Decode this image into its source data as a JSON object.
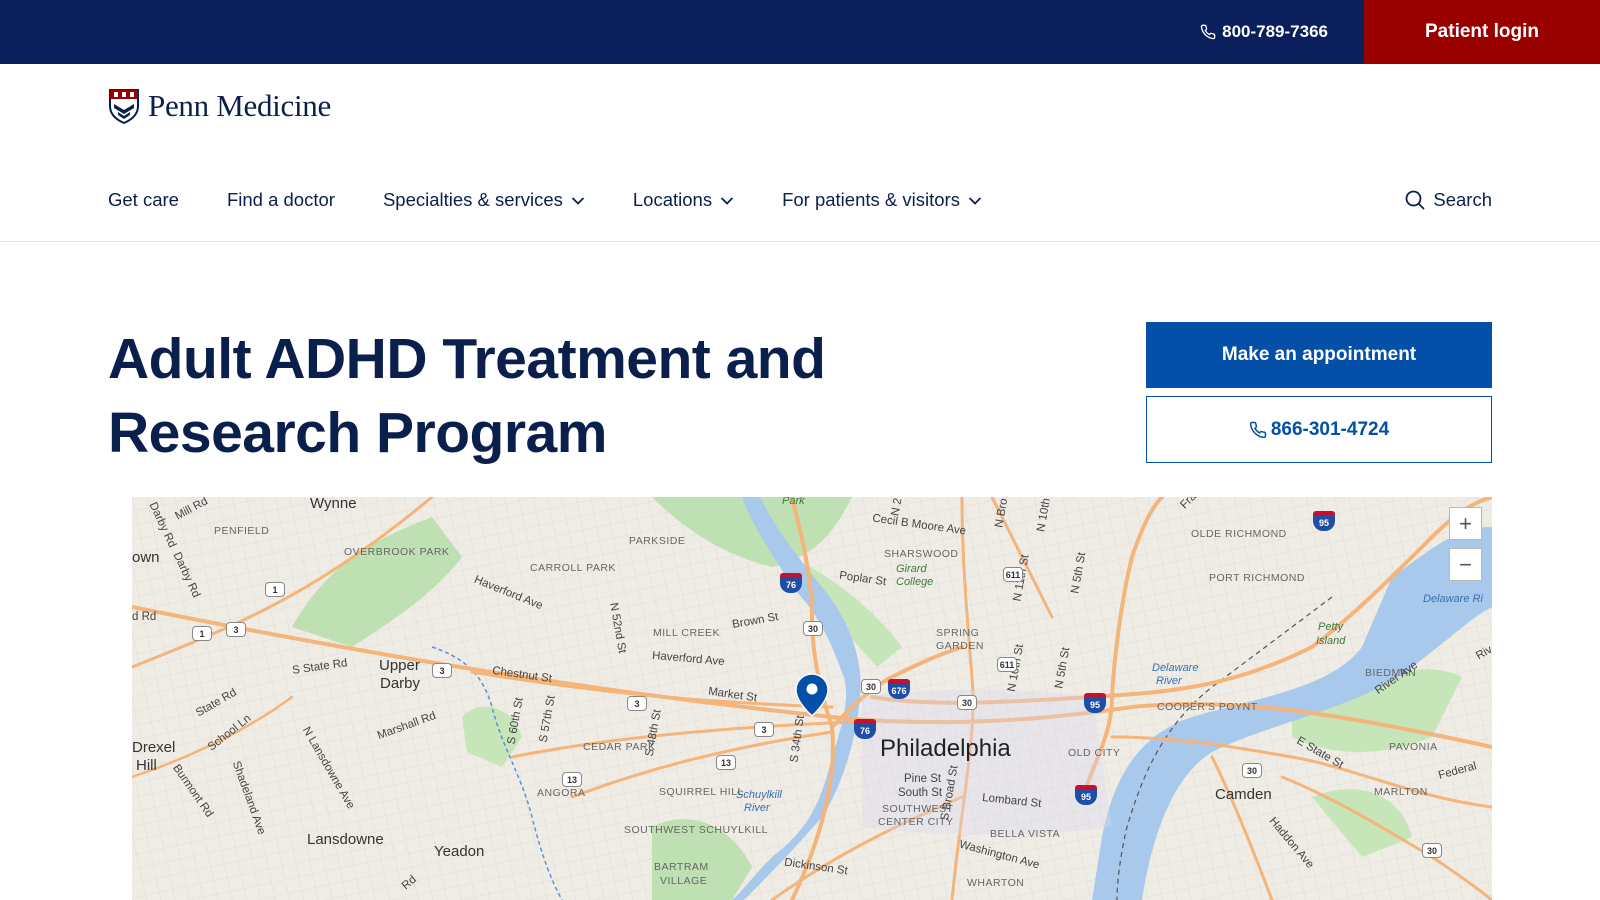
{
  "topbar": {
    "phone": "800-789-7366",
    "login": "Patient login"
  },
  "brand": {
    "name": "Penn Medicine"
  },
  "nav": {
    "items": [
      {
        "label": "Get care"
      },
      {
        "label": "Find a doctor"
      },
      {
        "label": "Specialties & services"
      },
      {
        "label": "Locations"
      },
      {
        "label": "For patients & visitors"
      }
    ],
    "search": "Search"
  },
  "page": {
    "title": "Adult ADHD Treatment and Research Program"
  },
  "actions": {
    "appointment": "Make an appointment",
    "phone": "866-301-4724"
  },
  "map": {
    "zoom_in": "+",
    "zoom_out": "−",
    "labels": {
      "philadelphia": "Philadelphia",
      "camden": "Camden",
      "wynne": "Wynne",
      "upper": "Upper",
      "darby": "Darby",
      "lansdowne": "Lansdowne",
      "yeadon": "Yeadon",
      "drexel": "Drexel",
      "hill": "Hill",
      "own": "own",
      "penfield": "PENFIELD",
      "overbrook_park": "OVERBROOK PARK",
      "carroll_park": "CARROLL PARK",
      "parkside": "PARKSIDE",
      "mill_creek": "MILL CREEK",
      "cedar_park": "CEDAR PARK",
      "angora": "ANGORA",
      "squirrel_hill": "SQUIRREL HILL",
      "southwest_schuylkill": "SOUTHWEST SCHUYLKILL",
      "bartram": "BARTRAM",
      "village": "VILLAGE",
      "sharswood": "SHARSWOOD",
      "spring": "SPRING",
      "garden": "GARDEN",
      "old_city": "OLD CITY",
      "southwest": "SOUTHWEST",
      "center_city": "CENTER CITY",
      "bella_vista": "BELLA VISTA",
      "wharton": "WHARTON",
      "olde_richmond": "OLDE RICHMOND",
      "port_richmond": "PORT RICHMOND",
      "biedman": "BIEDMAN",
      "coopers_poynt": "COOPER'S POYNT",
      "pavonia": "PAVONIA",
      "marlton": "MARLTON",
      "girard": "Girard",
      "college": "College",
      "park": "Park",
      "petty": "Petty",
      "island": "Island",
      "delaware_ri": "Delaware Ri",
      "delaware": "Delaware",
      "river": "River",
      "schuylkill": "Schuylkill",
      "river2": "River",
      "mill_rd": "Mill Rd",
      "darby_rd": "Darby Rd",
      "darby_rd2": "Darby Rd",
      "d_rd": "d Rd",
      "haverford_ave": "Haverford Ave",
      "haverford_ave2": "Haverford Ave",
      "n52": "N 52nd St",
      "brown_st": "Brown St",
      "poplar_st": "Poplar St",
      "cecil": "Cecil B Moore Ave",
      "s_state_rd": "S State Rd",
      "state_rd": "State Rd",
      "chestnut_st": "Chestnut St",
      "market_st": "Market St",
      "school_ln": "School Ln",
      "marshall_rd": "Marshall Rd",
      "n_lansdowne": "N Lansdowne Ave",
      "burmont": "Burmont Rd",
      "shadeland": "Shadeland Ave",
      "s60": "S 60th St",
      "s57": "S 57th St",
      "s48": "S 48th St",
      "s34": "S 34th St",
      "dickinson": "Dickinson St",
      "pine": "Pine St",
      "south_st": "South St",
      "s_broad": "S Broad St",
      "lombard": "Lombard St",
      "washington": "Washington Ave",
      "n2": "N 2",
      "n_broad": "N Bro",
      "n10": "N 10th",
      "n11": "N 11th St",
      "n5": "N 5th St",
      "n10b": "N 10th St",
      "n5b": "N 5th St",
      "river_ave": "River Ave",
      "e_state": "E State St",
      "haddon": "Haddon Ave",
      "federal": "Federal",
      "fra": "Fra",
      "riv": "Riv",
      "rd_bottom": "Rd"
    },
    "shields": {
      "us1a": "1",
      "us1b": "1",
      "pa3a": "3",
      "pa3b": "3",
      "pa3c": "3",
      "pa3d": "3",
      "pa13a": "13",
      "pa13b": "13",
      "us30a": "30",
      "us30b": "30",
      "us30c": "30",
      "us30d": "30",
      "us30e": "30",
      "pa611a": "611",
      "pa611b": "611",
      "i76a": "76",
      "i76b": "76",
      "i676": "676",
      "i95a": "95",
      "i95b": "95",
      "i95c": "95"
    }
  }
}
